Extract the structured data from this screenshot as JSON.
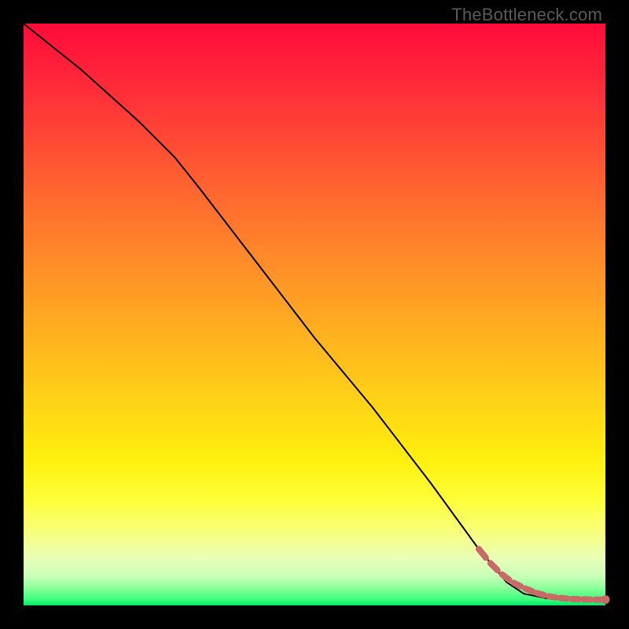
{
  "watermark": "TheBottleneck.com",
  "colors": {
    "gradient_top": "#ff0b3a",
    "gradient_bottom": "#00e66a",
    "curve": "#000000",
    "marker": "#c86a66",
    "background": "#000000"
  },
  "chart_data": {
    "type": "line",
    "title": "",
    "xlabel": "",
    "ylabel": "",
    "xlim": [
      0,
      100
    ],
    "ylim": [
      0,
      100
    ],
    "grid": false,
    "legend": false,
    "background_gradient": {
      "direction": "vertical",
      "stops": [
        {
          "pos": 0.0,
          "color": "#ff0b3a"
        },
        {
          "pos": 0.3,
          "color": "#ff6a2f"
        },
        {
          "pos": 0.6,
          "color": "#ffd616"
        },
        {
          "pos": 0.82,
          "color": "#feff3a"
        },
        {
          "pos": 0.95,
          "color": "#c8ffb8"
        },
        {
          "pos": 1.0,
          "color": "#00e66a"
        }
      ]
    },
    "series": [
      {
        "name": "bottleneck-curve",
        "style": "solid-black",
        "x": [
          0,
          10,
          20,
          26,
          30,
          40,
          50,
          60,
          70,
          78,
          83,
          86,
          90,
          95,
          100
        ],
        "y": [
          100,
          92,
          83,
          77,
          72,
          59,
          46,
          34,
          21,
          10,
          4,
          2,
          1.2,
          1.0,
          1.0
        ]
      }
    ],
    "markers": {
      "name": "highlight-tail",
      "style": "dashed-salmon-with-end-dot",
      "x": [
        78,
        80,
        82,
        84,
        86,
        88,
        90,
        92,
        94,
        96,
        98,
        100
      ],
      "y": [
        10,
        7.5,
        5.5,
        4,
        3,
        2.2,
        1.6,
        1.3,
        1.1,
        1.05,
        1.0,
        1.0
      ]
    }
  }
}
